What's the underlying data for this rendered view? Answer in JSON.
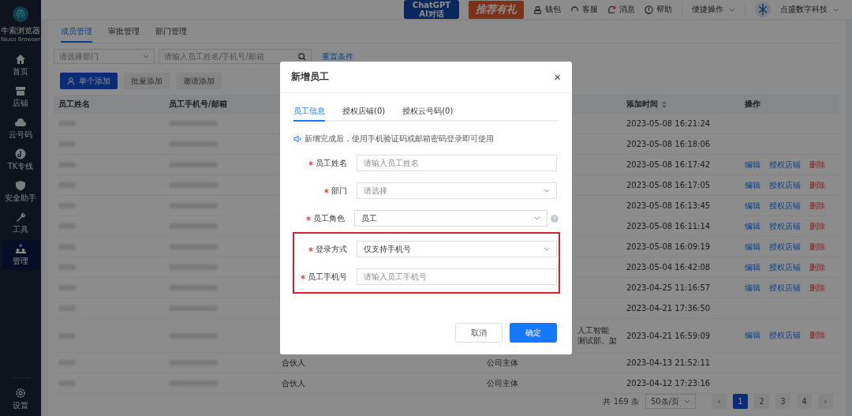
{
  "sidebar": {
    "logo_name": "牛索浏览器",
    "logo_sub": "Niuso Browser",
    "items": [
      {
        "label": "首页",
        "selected": false
      },
      {
        "label": "店铺",
        "selected": false
      },
      {
        "label": "云号码",
        "selected": false
      },
      {
        "label": "TK专线",
        "selected": false
      },
      {
        "label": "安全助手",
        "selected": false
      },
      {
        "label": "工具",
        "selected": false
      },
      {
        "label": "管理",
        "selected": true
      }
    ],
    "footer_item": {
      "label": "设置"
    }
  },
  "top_bar": {
    "chatgpt_badge": [
      "ChatGPT",
      "AI对话"
    ],
    "promo_badge": "推荐有礼",
    "links": [
      {
        "label": "钱包"
      },
      {
        "label": "客服"
      },
      {
        "label": "消息"
      },
      {
        "label": "帮助"
      }
    ],
    "quick_menu": "便捷操作",
    "company": "点盛数字科技"
  },
  "tabs": [
    {
      "label": "成员管理",
      "selected": true
    },
    {
      "label": "审批管理",
      "selected": false
    },
    {
      "label": "部门管理",
      "selected": false
    }
  ],
  "filters": {
    "department_placeholder": "请选择部门",
    "search_placeholder": "请输入员工姓名/手机号/邮箱",
    "reset_link": "重置条件"
  },
  "actions": [
    {
      "label": "单个添加",
      "primary": true
    },
    {
      "label": "批量添加",
      "primary": false
    },
    {
      "label": "邀请添加",
      "primary": false
    }
  ],
  "table": {
    "columns": [
      {
        "label": "员工姓名",
        "sortable": false
      },
      {
        "label": "员工手机号/邮箱",
        "sortable": false
      },
      {
        "label": "添加时间",
        "sortable": true
      },
      {
        "label": "操作",
        "sortable": false
      }
    ],
    "rows": [
      {
        "time": "2023-05-08 16:21:24"
      },
      {
        "time": "2023-05-08 16:18:06"
      },
      {
        "time": "2023-05-08 16:17:42",
        "actions": [
          "编辑",
          "授权店铺",
          "删除"
        ]
      },
      {
        "time": "2023-05-08 16:17:05",
        "actions": [
          "编辑",
          "授权店铺",
          "删除"
        ]
      },
      {
        "time": "2023-05-08 16:13:45",
        "actions": [
          "编辑",
          "授权店铺",
          "删除"
        ]
      },
      {
        "time": "2023-05-08 16:11:14",
        "actions": [
          "编辑",
          "授权店铺",
          "删除"
        ]
      },
      {
        "time": "2023-05-08 16:09:19",
        "actions": [
          "编辑",
          "授权店铺",
          "删除"
        ]
      },
      {
        "time": "2023-05-04 16:42:08",
        "actions": [
          "编辑",
          "授权店铺",
          "删除"
        ]
      },
      {
        "time": "2023-04-25 11:16:57",
        "actions": [
          "编辑",
          "授权店铺",
          "删除"
        ]
      },
      {
        "time": "2023-04-21 17:36:50"
      },
      {
        "time": "2023-04-21 16:59:09",
        "actions": [
          "编辑",
          "授权店铺",
          "删除"
        ],
        "department": [
          "人工智能",
          "测试部、架"
        ]
      },
      {
        "time": "2023-04-13 21:52:11",
        "role": "合伙人",
        "entity": "公司主体"
      },
      {
        "time": "2023-04-12 17:23:16",
        "role": "合伙人",
        "entity": "公司主体"
      }
    ]
  },
  "pagination": {
    "total": "共 169 条",
    "page_size": "50条/页",
    "prev": "‹",
    "next": "›",
    "pages": [
      {
        "label": "1",
        "selected": true
      },
      {
        "label": "2",
        "selected": false
      },
      {
        "label": "3",
        "selected": false
      },
      {
        "label": "4",
        "selected": false
      }
    ]
  },
  "dialog": {
    "title": "新增员工",
    "close": "×",
    "tabs": [
      {
        "label": "员工信息",
        "selected": true
      },
      {
        "label": "授权店铺(0)",
        "selected": false
      },
      {
        "label": "授权云号码(0)",
        "selected": false
      }
    ],
    "notice": "新增完成后，使用手机验证码或邮箱密码登录即可使用",
    "fields": [
      {
        "label": "员工姓名",
        "kind": "input",
        "required": true,
        "placeholder": "请输入员工姓名",
        "help": false,
        "highlighted": false
      },
      {
        "label": "部门",
        "kind": "select",
        "required": true,
        "placeholder": "请选择",
        "help": false,
        "highlighted": false
      },
      {
        "label": "员工角色",
        "kind": "select",
        "required": true,
        "value": "员工",
        "help": true,
        "highlighted": false
      },
      {
        "label": "登录方式",
        "kind": "select",
        "required": true,
        "value": "仅支持手机号",
        "help": false,
        "highlighted": true
      },
      {
        "label": "员工手机号",
        "kind": "input",
        "required": true,
        "placeholder": "请输入员工手机号",
        "help": false,
        "highlighted": true
      }
    ],
    "cancel": "取消",
    "confirm": "确定"
  }
}
